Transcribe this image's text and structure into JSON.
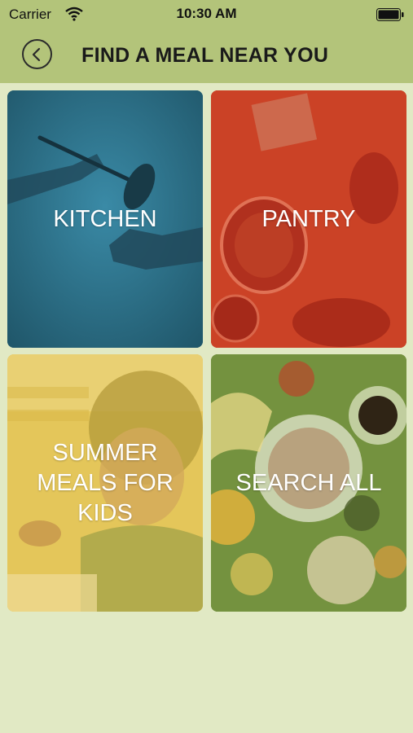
{
  "status": {
    "carrier": "Carrier",
    "time": "10:30 AM"
  },
  "header": {
    "title": "FIND A MEAL NEAR YOU",
    "back_icon": "chevron-left-icon"
  },
  "tiles": [
    {
      "label": "KITCHEN",
      "color": "#2b6a81"
    },
    {
      "label": "PANTRY",
      "color": "#c8341e"
    },
    {
      "label": "SUMMER MEALS FOR KIDS",
      "color": "#e1c552"
    },
    {
      "label": "SEARCH ALL",
      "color": "#6b8a3a"
    }
  ]
}
